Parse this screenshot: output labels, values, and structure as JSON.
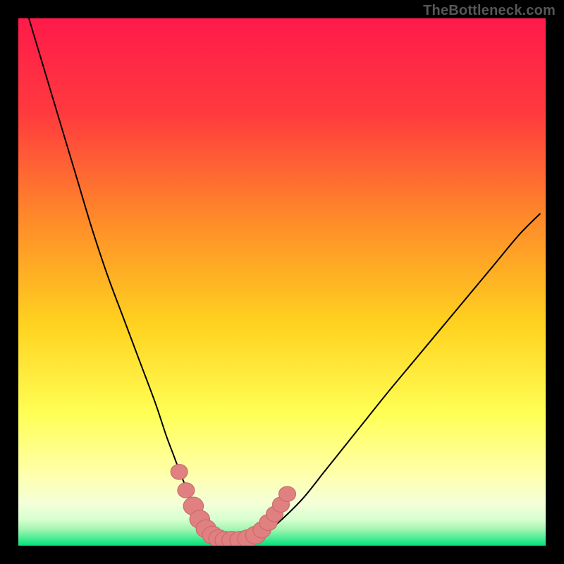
{
  "watermark_text": "TheBottleneck.com",
  "colors": {
    "frame": "#000000",
    "grad_top": "#ff1a4a",
    "grad_mid1": "#ff6a2a",
    "grad_mid2": "#ffd21f",
    "grad_mid3": "#ffff66",
    "grad_low": "#f8ffd0",
    "grad_bottom": "#00e47a",
    "curve": "#000000",
    "marker_fill": "#e08080",
    "marker_stroke": "#c76a6a"
  },
  "chart_data": {
    "type": "line",
    "title": "",
    "xlabel": "",
    "ylabel": "",
    "xlim": [
      0,
      100
    ],
    "ylim": [
      0,
      100
    ],
    "series": [
      {
        "name": "bottleneck-curve",
        "x": [
          2,
          5,
          8,
          11,
          14,
          17,
          20,
          23,
          26,
          28,
          29.5,
          31,
          32.5,
          34,
          35.5,
          37,
          38.5,
          40,
          42,
          44,
          47,
          50,
          54,
          58,
          62,
          66,
          70,
          75,
          80,
          85,
          90,
          95,
          99
        ],
        "y": [
          100,
          90,
          80,
          70,
          60,
          51,
          43,
          35,
          27,
          21,
          17,
          13,
          9.5,
          6.5,
          4,
          2.3,
          1.2,
          1,
          1,
          1.2,
          2.5,
          5,
          9,
          14,
          19,
          24,
          29,
          35,
          41,
          47,
          53,
          59,
          63
        ]
      }
    ],
    "markers": [
      {
        "x": 30.5,
        "y": 14,
        "r": 1.6
      },
      {
        "x": 31.8,
        "y": 10.5,
        "r": 1.6
      },
      {
        "x": 33.2,
        "y": 7.5,
        "r": 1.9
      },
      {
        "x": 34.4,
        "y": 5.0,
        "r": 1.9
      },
      {
        "x": 35.6,
        "y": 3.2,
        "r": 1.9
      },
      {
        "x": 36.8,
        "y": 2.0,
        "r": 1.9
      },
      {
        "x": 38.0,
        "y": 1.3,
        "r": 1.9
      },
      {
        "x": 39.2,
        "y": 1.0,
        "r": 1.9
      },
      {
        "x": 40.5,
        "y": 1.0,
        "r": 1.9
      },
      {
        "x": 42.0,
        "y": 1.0,
        "r": 1.9
      },
      {
        "x": 43.5,
        "y": 1.3,
        "r": 1.9
      },
      {
        "x": 45.0,
        "y": 2.0,
        "r": 1.9
      },
      {
        "x": 46.2,
        "y": 3.0,
        "r": 1.7
      },
      {
        "x": 47.4,
        "y": 4.4,
        "r": 1.7
      },
      {
        "x": 48.6,
        "y": 6.0,
        "r": 1.6
      },
      {
        "x": 49.8,
        "y": 7.8,
        "r": 1.6
      },
      {
        "x": 51.0,
        "y": 9.8,
        "r": 1.6
      }
    ],
    "annotations": []
  }
}
